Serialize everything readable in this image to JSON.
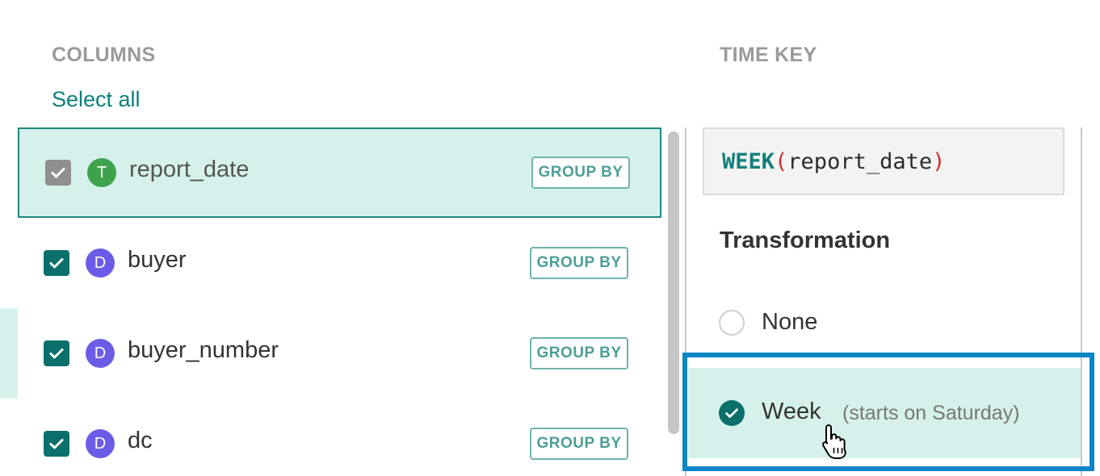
{
  "columns_section": {
    "label": "COLUMNS",
    "select_all": "Select all",
    "rows": [
      {
        "name": "report_date",
        "type_badge": "T",
        "checked": true,
        "disabled": true,
        "group_by": "GROUP BY"
      },
      {
        "name": "buyer",
        "type_badge": "D",
        "checked": true,
        "group_by": "GROUP BY"
      },
      {
        "name": "buyer_number",
        "type_badge": "D",
        "checked": true,
        "group_by": "GROUP BY"
      },
      {
        "name": "dc",
        "type_badge": "D",
        "checked": true,
        "group_by": "GROUP BY"
      }
    ]
  },
  "time_key_section": {
    "label": "TIME KEY",
    "expression": {
      "function": "WEEK",
      "open_paren": "(",
      "argument": "report_date",
      "close_paren": ")"
    },
    "transformation_heading": "Transformation",
    "options": [
      {
        "label": "None",
        "note": "",
        "selected": false
      },
      {
        "label": "Week",
        "note": "(starts on Saturday)",
        "selected": true
      }
    ]
  },
  "colors": {
    "accent": "#0b6f6b",
    "selected_bg": "#d6f1ec",
    "highlight": "#0a85c7",
    "badge_text": "#3fa34d",
    "badge_dimension": "#6b5ce7"
  },
  "icons": {
    "checkbox": "checkmark-icon",
    "cursor": "hand-pointer-icon"
  }
}
